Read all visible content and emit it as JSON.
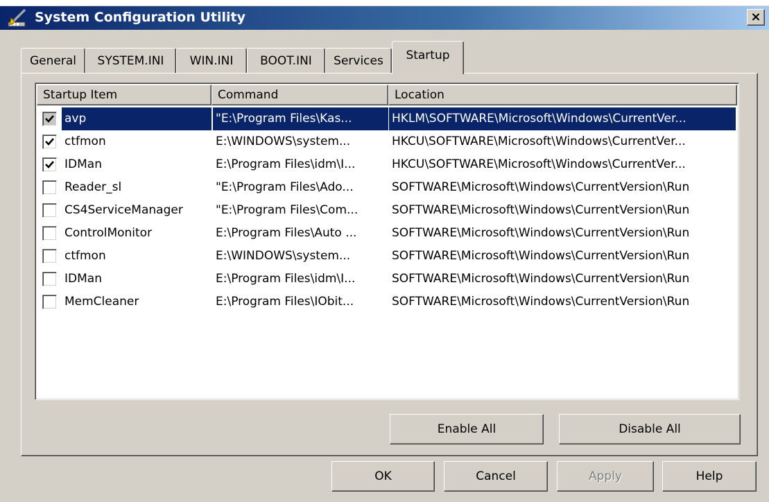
{
  "window": {
    "title": "System Configuration Utility",
    "icon": "msconfig-icon",
    "close_label": "×"
  },
  "tabs": [
    {
      "label": "General",
      "active": false
    },
    {
      "label": "SYSTEM.INI",
      "active": false
    },
    {
      "label": "WIN.INI",
      "active": false
    },
    {
      "label": "BOOT.INI",
      "active": false
    },
    {
      "label": "Services",
      "active": false
    },
    {
      "label": "Startup",
      "active": true
    }
  ],
  "list": {
    "columns": [
      "Startup Item",
      "Command",
      "Location"
    ],
    "rows": [
      {
        "item": "avp",
        "command": "\"E:\\Program Files\\Kas...",
        "location": "HKLM\\SOFTWARE\\Microsoft\\Windows\\CurrentVer...",
        "checked": true,
        "selected": true
      },
      {
        "item": "ctfmon",
        "command": "E:\\WINDOWS\\system...",
        "location": "HKCU\\SOFTWARE\\Microsoft\\Windows\\CurrentVer...",
        "checked": true,
        "selected": false
      },
      {
        "item": "IDMan",
        "command": "E:\\Program Files\\idm\\I...",
        "location": "HKCU\\SOFTWARE\\Microsoft\\Windows\\CurrentVer...",
        "checked": true,
        "selected": false
      },
      {
        "item": "Reader_sl",
        "command": "\"E:\\Program Files\\Ado...",
        "location": "SOFTWARE\\Microsoft\\Windows\\CurrentVersion\\Run",
        "checked": false,
        "selected": false
      },
      {
        "item": "CS4ServiceManager",
        "command": "\"E:\\Program Files\\Com...",
        "location": "SOFTWARE\\Microsoft\\Windows\\CurrentVersion\\Run",
        "checked": false,
        "selected": false
      },
      {
        "item": "ControlMonitor",
        "command": "E:\\Program Files\\Auto ...",
        "location": "SOFTWARE\\Microsoft\\Windows\\CurrentVersion\\Run",
        "checked": false,
        "selected": false
      },
      {
        "item": "ctfmon",
        "command": "E:\\WINDOWS\\system...",
        "location": "SOFTWARE\\Microsoft\\Windows\\CurrentVersion\\Run",
        "checked": false,
        "selected": false
      },
      {
        "item": "IDMan",
        "command": "E:\\Program Files\\idm\\I...",
        "location": "SOFTWARE\\Microsoft\\Windows\\CurrentVersion\\Run",
        "checked": false,
        "selected": false
      },
      {
        "item": "MemCleaner",
        "command": "E:\\Program Files\\IObit...",
        "location": "SOFTWARE\\Microsoft\\Windows\\CurrentVersion\\Run",
        "checked": false,
        "selected": false
      }
    ]
  },
  "panel_buttons": {
    "enable_all": "Enable All",
    "disable_all": "Disable All"
  },
  "dialog_buttons": {
    "ok": "OK",
    "cancel": "Cancel",
    "apply": "Apply",
    "apply_disabled": true,
    "help": "Help"
  },
  "colors": {
    "face": "#d4d0c8",
    "title_start": "#0a246a",
    "title_end": "#a6caf0",
    "selection": "#0a246a"
  }
}
